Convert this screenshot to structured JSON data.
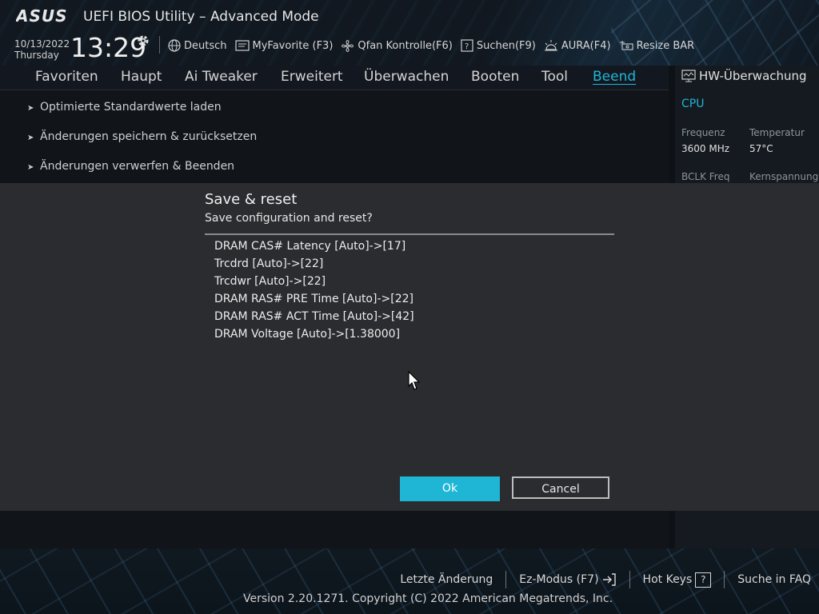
{
  "header": {
    "logo_text": "ASUS",
    "title": "UEFI BIOS Utility – Advanced Mode",
    "date": "10/13/2022",
    "weekday": "Thursday",
    "time": "13:29",
    "toolbar": [
      {
        "icon": "globe-icon",
        "label": "Deutsch"
      },
      {
        "icon": "favorite-icon",
        "label": "MyFavorite (F3)"
      },
      {
        "icon": "fan-icon",
        "label": "Qfan Kontrolle(F6)"
      },
      {
        "icon": "search-icon",
        "label": "Suchen(F9)"
      },
      {
        "icon": "aura-icon",
        "label": "AURA(F4)"
      },
      {
        "icon": "resize-bar-icon",
        "label": "Resize BAR"
      }
    ]
  },
  "nav": {
    "tabs": [
      "Favoriten",
      "Haupt",
      "Ai Tweaker",
      "Erweitert",
      "Überwachen",
      "Booten",
      "Tool",
      "Beend"
    ],
    "active": "Beend"
  },
  "main": {
    "items": [
      "Optimierte Standardwerte laden",
      "Änderungen speichern & zurücksetzen",
      "Änderungen verwerfen & Beenden"
    ]
  },
  "hw_monitor": {
    "title": "HW-Überwachung",
    "section": "CPU",
    "labels": [
      "Frequenz",
      "Temperatur",
      "BCLK Freq",
      "Kernspannung"
    ],
    "values": [
      "3600 MHz",
      "57°C"
    ]
  },
  "dialog": {
    "title": "Save & reset",
    "subtitle": "Save configuration and reset?",
    "changes": [
      "DRAM CAS# Latency [Auto]->[17]",
      "Trcdrd [Auto]->[22]",
      "Trcdwr [Auto]->[22]",
      "DRAM RAS# PRE Time [Auto]->[22]",
      "DRAM RAS# ACT Time [Auto]->[42]",
      "DRAM Voltage [Auto]->[1.38000]"
    ],
    "ok_label": "Ok",
    "cancel_label": "Cancel"
  },
  "footer": {
    "links": [
      "Letzte Änderung",
      "Ez-Modus (F7)",
      "Hot Keys",
      "Suche in FAQ"
    ],
    "hotkeys_glyph": "?",
    "copyright": "Version 2.20.1271. Copyright (C) 2022 American Megatrends, Inc."
  },
  "colors": {
    "accent": "#1fb6d6",
    "background": "#111419",
    "dialog_bg": "#2a2c2f"
  }
}
